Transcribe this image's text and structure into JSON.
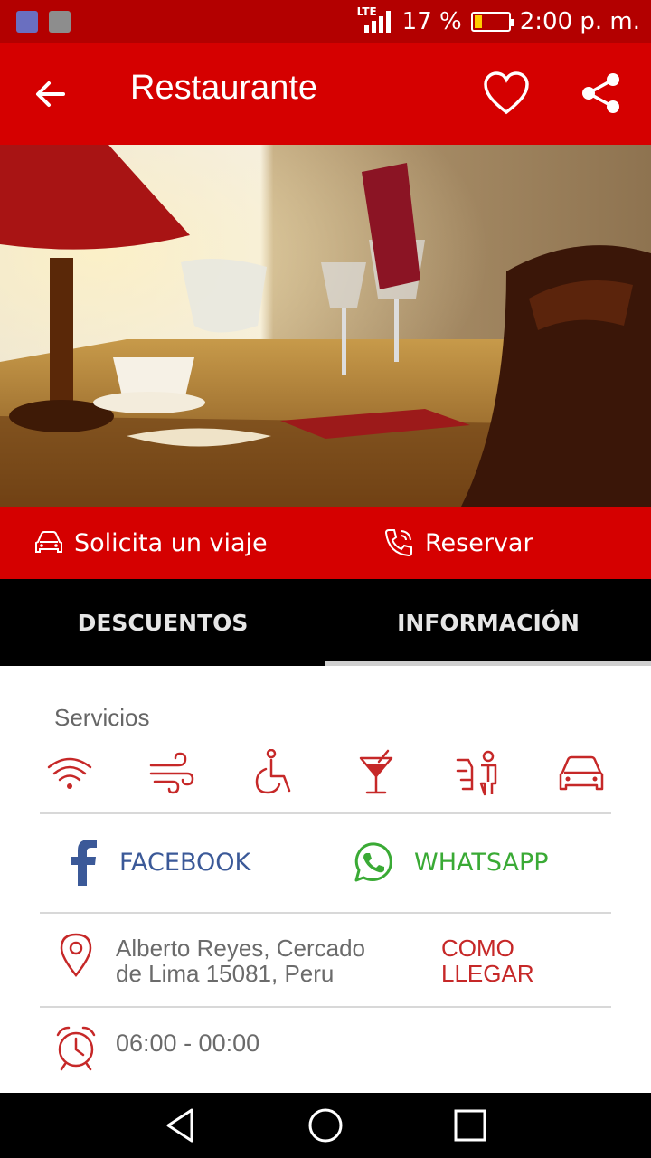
{
  "status_bar": {
    "network": "LTE",
    "battery_percent": "17 %",
    "time": "2:00 p. m."
  },
  "app_bar": {
    "title": "Restaurante"
  },
  "hero": {
    "slide_count": 3,
    "active_slide": 1
  },
  "actions": {
    "ride_label": "Solicita un viaje",
    "reserve_label": "Reservar"
  },
  "tabs": [
    {
      "label": "DESCUENTOS",
      "selected": false
    },
    {
      "label": "INFORMACIÓN",
      "selected": true
    }
  ],
  "services": {
    "title": "Servicios",
    "icons": [
      "wifi-icon",
      "air-conditioning-icon",
      "accessible-icon",
      "cocktail-icon",
      "valet-parking-icon",
      "parking-icon"
    ]
  },
  "social": {
    "facebook_label": "FACEBOOK",
    "whatsapp_label": "WHATSAPP"
  },
  "address": {
    "text": "Alberto Reyes, Cercado de Lima 15081, Peru",
    "line1": "Alberto Reyes, Cercado",
    "line2": "de Lima 15081, Peru",
    "directions_line1": "COMO",
    "directions_line2": "LLEGAR"
  },
  "hours": {
    "text": "06:00 - 00:00"
  },
  "colors": {
    "primary": "#d50000",
    "status_bar": "#b30000",
    "facebook": "#3b5998",
    "whatsapp": "#3aaa35",
    "icon_red": "#c62828"
  }
}
